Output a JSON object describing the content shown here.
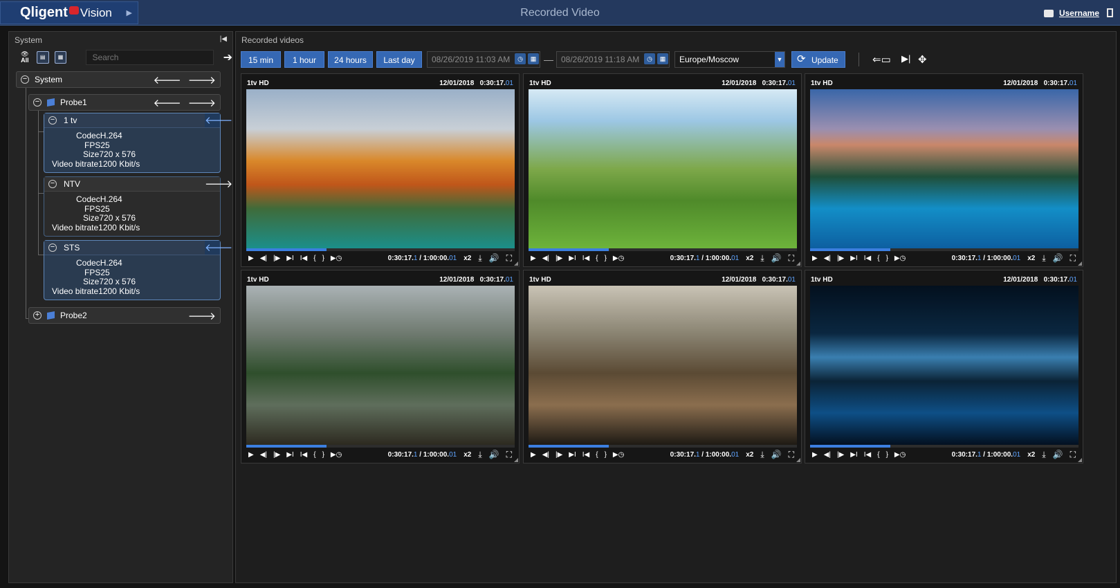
{
  "app": {
    "brand_left": "Qligent",
    "brand_right": "Vision",
    "title": "Recorded Video",
    "username": "Username"
  },
  "left_panel": {
    "title": "System",
    "tool_all_label": "All",
    "search_placeholder": "Search",
    "tree": {
      "root_label": "System",
      "probe1_label": "Probe1",
      "probe2_label": "Probe2",
      "channels": [
        {
          "name": "1 tv",
          "codec": "CodecH.264",
          "fps": "FPS25",
          "size": "Size720 x 576",
          "bitrate": "Video bitrate1200 Kbit/s"
        },
        {
          "name": "NTV",
          "codec": "CodecH.264",
          "fps": "FPS25",
          "size": "Size720 x 576",
          "bitrate": "Video bitrate1200 Kbit/s"
        },
        {
          "name": "STS",
          "codec": "CodecH.264",
          "fps": "FPS25",
          "size": "Size720 x 576",
          "bitrate": "Video bitrate1200 Kbit/s"
        }
      ]
    }
  },
  "right_panel": {
    "title": "Recorded videos",
    "toolbar": {
      "range_15min": "15 min",
      "range_1hour": "1 hour",
      "range_24hours": "24 hours",
      "range_lastday": "Last day",
      "date_from": "08/26/2019 11:03 AM",
      "date_to": "08/26/2019 11:18 AM",
      "separator": "—",
      "timezone": "Europe/Moscow",
      "update_label": "Update"
    },
    "tiles": [
      {
        "channel": "1tv HD",
        "date": "12/01/2018",
        "time": "0:30:17.",
        "time_ms": "01",
        "pos": "0:30:17.",
        "pos_ms": "1",
        "dur": " / 1:00:00.",
        "dur_ms": "01",
        "speed": "x2",
        "progress": 0.3
      },
      {
        "channel": "1tv HD",
        "date": "12/01/2018",
        "time": "0:30:17.",
        "time_ms": "01",
        "pos": "0:30:17.",
        "pos_ms": "1",
        "dur": " / 1:00:00.",
        "dur_ms": "01",
        "speed": "x2",
        "progress": 0.3
      },
      {
        "channel": "1tv HD",
        "date": "12/01/2018",
        "time": "0:30:17.",
        "time_ms": "01",
        "pos": "0:30:17.",
        "pos_ms": "1",
        "dur": " / 1:00:00.",
        "dur_ms": "01",
        "speed": "x2",
        "progress": 0.3
      },
      {
        "channel": "1tv HD",
        "date": "12/01/2018",
        "time": "0:30:17.",
        "time_ms": "01",
        "pos": "0:30:17.",
        "pos_ms": "1",
        "dur": " / 1:00:00.",
        "dur_ms": "01",
        "speed": "x2",
        "progress": 0.3
      },
      {
        "channel": "1tv HD",
        "date": "12/01/2018",
        "time": "0:30:17.",
        "time_ms": "01",
        "pos": "0:30:17.",
        "pos_ms": "1",
        "dur": " / 1:00:00.",
        "dur_ms": "01",
        "speed": "x2",
        "progress": 0.3
      },
      {
        "channel": "1tv HD",
        "date": "12/01/2018",
        "time": "0:30:17.",
        "time_ms": "01",
        "pos": "0:30:17.",
        "pos_ms": "1",
        "dur": " / 1:00:00.",
        "dur_ms": "01",
        "speed": "x2",
        "progress": 0.3
      }
    ]
  },
  "colors": {
    "accent": "#3568b4",
    "topbar": "#24395e",
    "time_highlight": "#5fa4ff"
  }
}
